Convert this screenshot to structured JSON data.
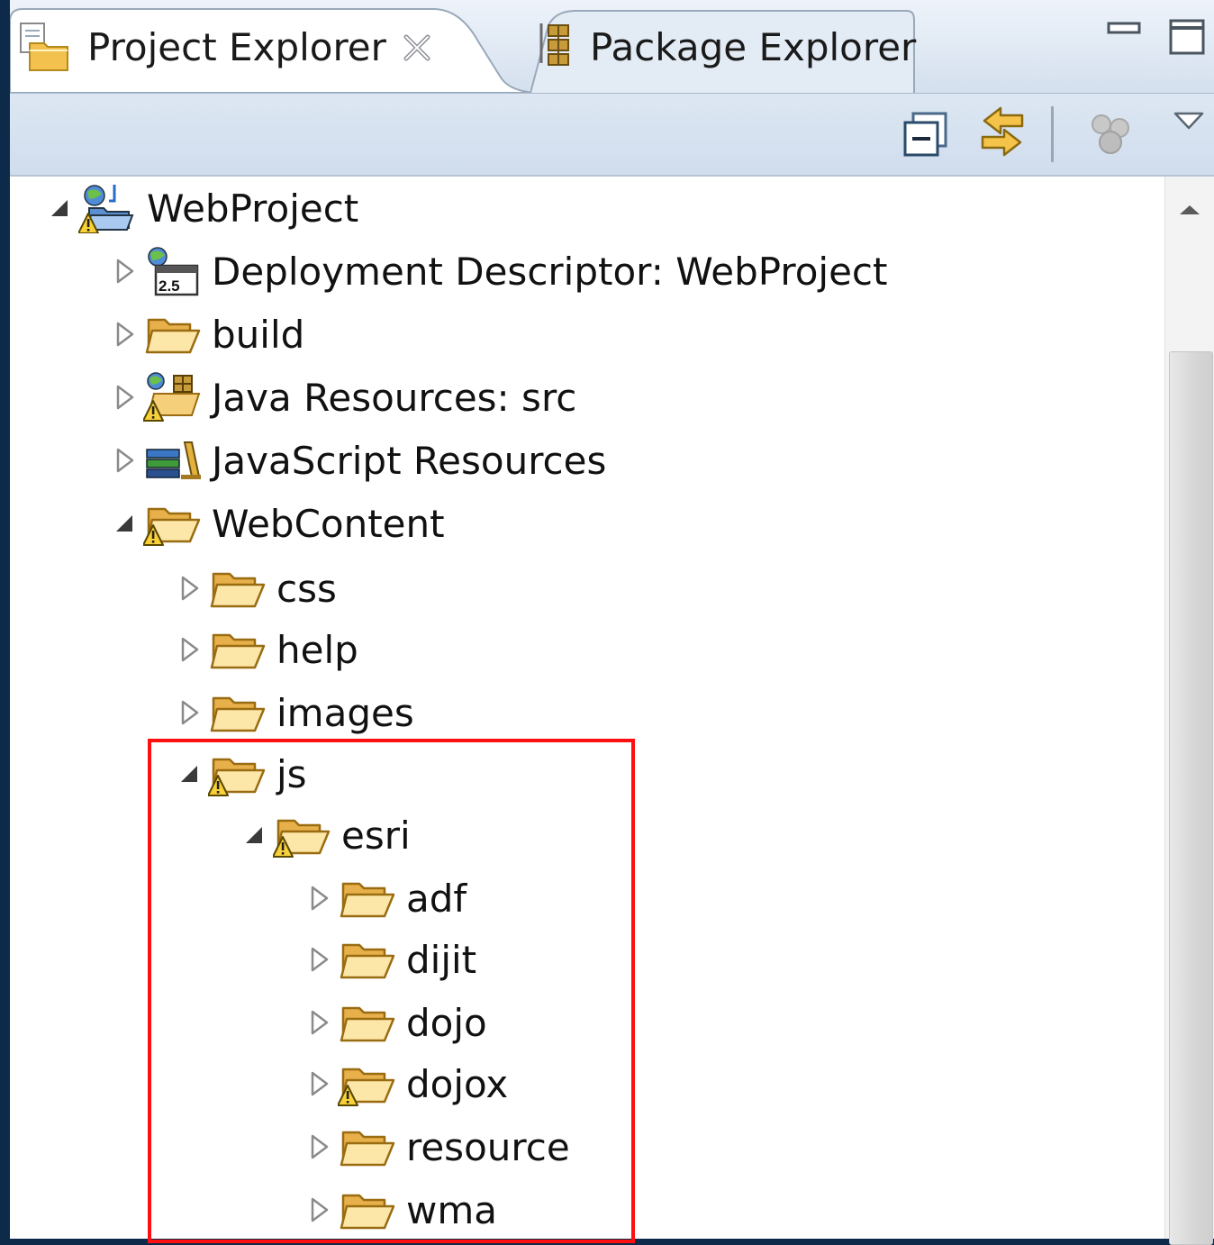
{
  "tabs": {
    "project_explorer": "Project Explorer",
    "package_explorer": "Package Explorer"
  },
  "toolbar": {
    "collapse_all_icon": "collapse-all-icon",
    "link_editor_icon": "link-with-editor-icon",
    "filter_icon": "filter-icon",
    "view_menu_icon": "view-menu-icon"
  },
  "tree": {
    "root": {
      "label": "WebProject",
      "expanded": true
    },
    "items": [
      {
        "label": "Deployment Descriptor: WebProject",
        "expanded": false,
        "icon": "deployment-descriptor-icon"
      },
      {
        "label": "build",
        "expanded": false,
        "icon": "folder-icon"
      },
      {
        "label": "Java Resources: src",
        "expanded": false,
        "icon": "java-resources-icon"
      },
      {
        "label": "JavaScript Resources",
        "expanded": false,
        "icon": "javascript-resources-icon"
      },
      {
        "label": "WebContent",
        "expanded": true,
        "icon": "warning-folder-icon"
      }
    ],
    "webcontent_children": [
      {
        "label": "css",
        "expanded": false
      },
      {
        "label": "help",
        "expanded": false
      },
      {
        "label": "images",
        "expanded": false
      },
      {
        "label": "js",
        "expanded": true,
        "warning": true
      }
    ],
    "js_children": [
      {
        "label": "esri",
        "expanded": true,
        "warning": true
      }
    ],
    "esri_children": [
      {
        "label": "adf",
        "expanded": false,
        "warning": false
      },
      {
        "label": "dijit",
        "expanded": false,
        "warning": false
      },
      {
        "label": "dojo",
        "expanded": false,
        "warning": false
      },
      {
        "label": "dojox",
        "expanded": false,
        "warning": true
      },
      {
        "label": "resource",
        "expanded": false,
        "warning": false
      },
      {
        "label": "wma",
        "expanded": false,
        "warning": false
      }
    ]
  },
  "colors": {
    "highlight": "#ff1010",
    "folder": "#f5c96a",
    "background_frame": "#0d2a4a"
  }
}
